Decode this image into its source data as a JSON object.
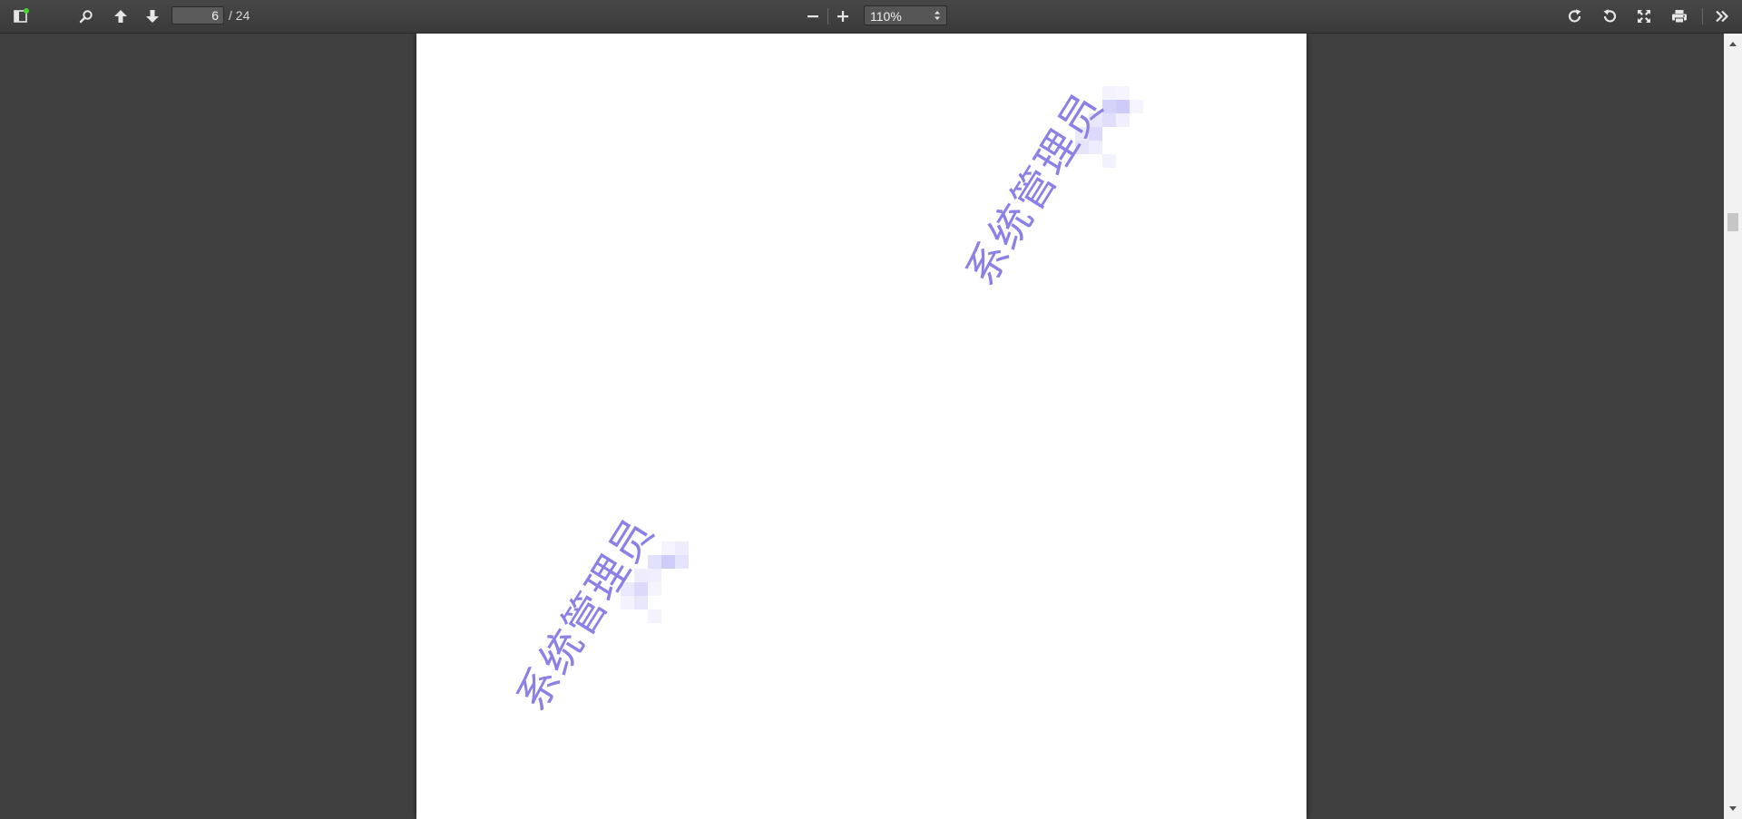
{
  "toolbar": {
    "page_current": "6",
    "page_total": "/ 24",
    "zoom_value": "110%",
    "icons": {
      "sidebar": "sidebar-toggle-icon",
      "search": "search-icon",
      "prev": "arrow-up-icon",
      "next": "arrow-down-icon",
      "zoom_out": "minus-icon",
      "zoom_in": "plus-icon",
      "rotate_cw": "rotate-clockwise-icon",
      "rotate_ccw": "rotate-counterclockwise-icon",
      "fullscreen": "fullscreen-icon",
      "print": "print-icon",
      "more": "double-chevron-right-icon"
    },
    "notification_color": "#4cd137"
  },
  "document": {
    "watermarks": [
      {
        "text": "系统管理员"
      },
      {
        "text": "系统管理员"
      }
    ],
    "watermark_color": "#8a80e6"
  }
}
